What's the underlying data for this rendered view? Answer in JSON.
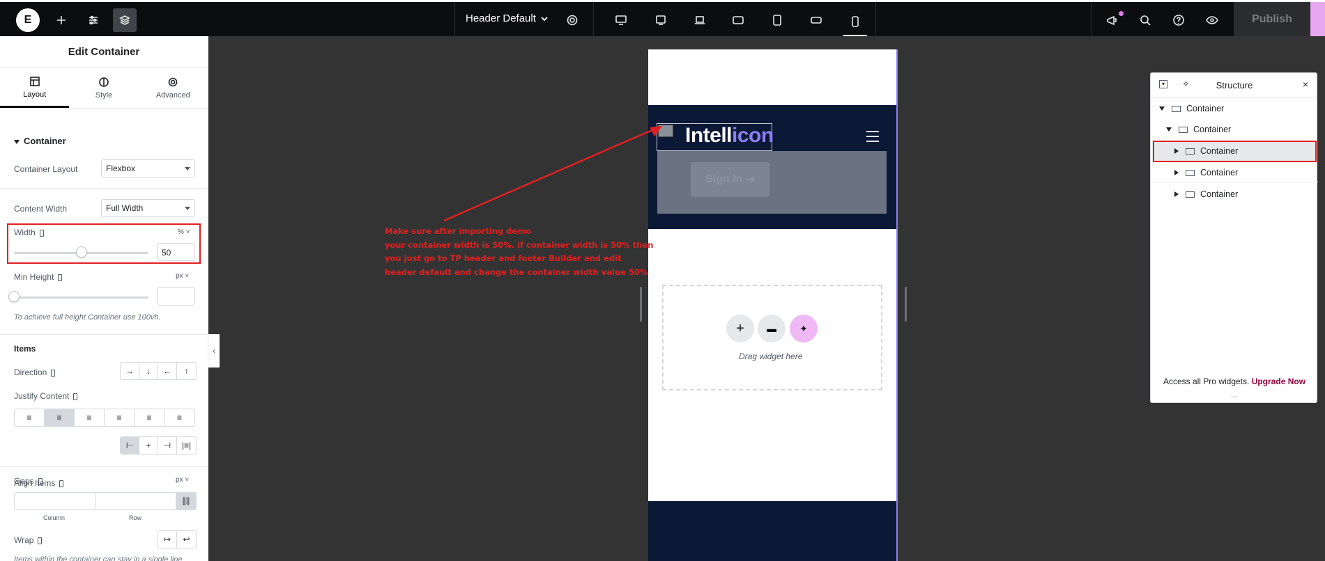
{
  "topbar": {
    "doc_title": "Header Default",
    "publish_label": "Publish"
  },
  "panel": {
    "title": "Edit Container",
    "tabs": [
      {
        "label": "Layout",
        "icon": "layout-icon"
      },
      {
        "label": "Style",
        "icon": "style-icon"
      },
      {
        "label": "Advanced",
        "icon": "gear-icon"
      }
    ],
    "section_container": "Container",
    "container_layout_label": "Container Layout",
    "container_layout_value": "Flexbox",
    "content_width_label": "Content Width",
    "content_width_value": "Full Width",
    "width_label": "Width",
    "width_unit": "%",
    "width_value": "50",
    "width_fraction": 0.5,
    "min_height_label": "Min Height",
    "min_height_unit": "px",
    "min_height_value": "",
    "min_height_hint": "To achieve full height Container use 100vh.",
    "items_title": "Items",
    "direction_label": "Direction",
    "justify_label": "Justify Content",
    "align_label": "Align Items",
    "gaps_label": "Gaps",
    "gaps_unit": "px",
    "gap_column_label": "Column",
    "gap_row_label": "Row",
    "wrap_label": "Wrap",
    "wrap_hint": "Items within the container can stay in a single line"
  },
  "canvas": {
    "logo_main": "Intell",
    "logo_accent": "icon",
    "signin_label": "Sign In",
    "drag_hint": "Drag widget here"
  },
  "annotation": {
    "line1": "Make sure after importing demo",
    "line2": "your container width is 50%. if container width is 50% then",
    "line3": "you just go to TP header and footer Builder and edit",
    "line4": "header default and change the container width value 50%"
  },
  "structure": {
    "title": "Structure",
    "items": [
      "Container",
      "Container",
      "Container",
      "Container",
      "Container"
    ],
    "footer_text": "Access all Pro widgets.",
    "upgrade_label": "Upgrade Now"
  },
  "colors": {
    "annotation_red": "#e02020",
    "canvas_bg": "#333333",
    "header_navy": "#0b1836",
    "accent_purple": "#8c7ff0",
    "upgrade_color": "#93003c"
  }
}
